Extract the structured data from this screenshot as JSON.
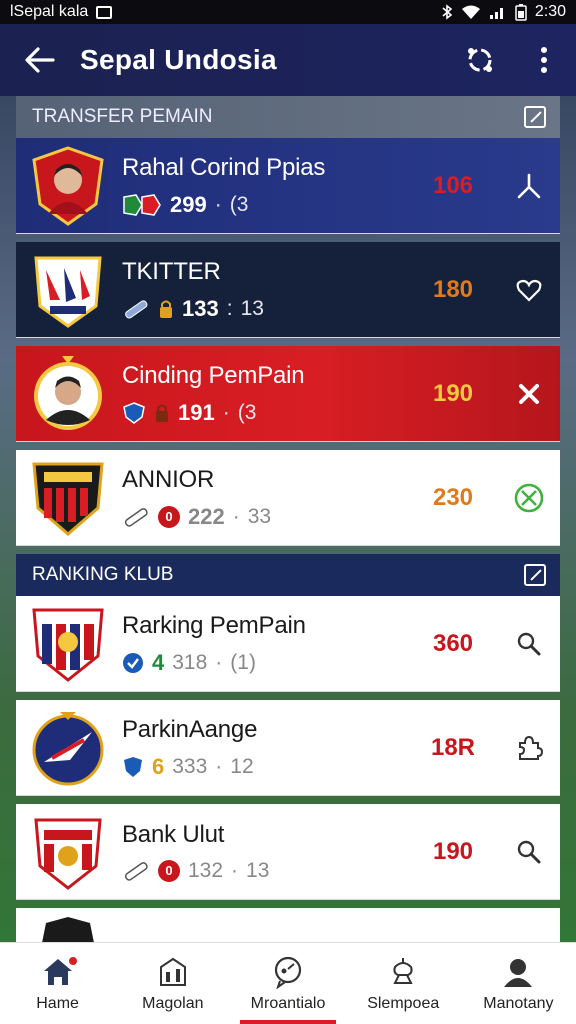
{
  "status_bar": {
    "left_text": "lSepal kala",
    "time": "2:30"
  },
  "app_bar": {
    "title": "Sepal Undosia"
  },
  "transfer_section": {
    "title": "TRANSFER PEMAIN",
    "items": [
      {
        "name": "Rahal Corind Ppias",
        "stat_main": "299",
        "stat_sub": "(3",
        "value": "106",
        "value_color": "#d81e24",
        "action_icon": "share-icon",
        "style": "blue"
      },
      {
        "name": "TKITTER",
        "stat_main": "133",
        "stat_sub": "13",
        "value": "180",
        "value_color": "#e07a1a",
        "action_icon": "heart-icon",
        "style": "navy"
      },
      {
        "name": "Cinding PemPain",
        "stat_main": "191",
        "stat_sub": "(3",
        "value": "190",
        "value_color": "#f5c842",
        "action_icon": "close-icon",
        "style": "red"
      },
      {
        "name": "ANNIOR",
        "stat_main": "222",
        "stat_sub": "33",
        "value": "230",
        "value_color": "#e07a1a",
        "action_icon": "check-circle-icon",
        "style": "white"
      }
    ]
  },
  "ranking_section": {
    "title": "RANKING KLUB",
    "items": [
      {
        "name": "Rarking PemPain",
        "badge": "4",
        "badge_color": "#1f8a3a",
        "stat_main": "318",
        "stat_sub": "(1)",
        "value": "360",
        "value_color": "#c8161d",
        "action_icon": "search-icon"
      },
      {
        "name": "ParkinAange",
        "badge": "6",
        "badge_color": "#e0a21a",
        "stat_main": "333",
        "stat_sub": "12",
        "value": "18R",
        "value_color": "#c8161d",
        "action_icon": "puzzle-icon"
      },
      {
        "name": "Bank Ulut",
        "badge": "",
        "badge_color": "#c8161d",
        "stat_main": "132",
        "stat_sub": "13",
        "value": "190",
        "value_color": "#c8161d",
        "action_icon": "search-icon"
      }
    ]
  },
  "bottom_nav": {
    "items": [
      {
        "label": "Hame",
        "icon": "home-icon"
      },
      {
        "label": "Magolan",
        "icon": "building-icon"
      },
      {
        "label": "Mroantialo",
        "icon": "chat-icon",
        "active": true
      },
      {
        "label": "Slempoea",
        "icon": "trophy-icon"
      },
      {
        "label": "Manotany",
        "icon": "profile-icon"
      }
    ]
  }
}
